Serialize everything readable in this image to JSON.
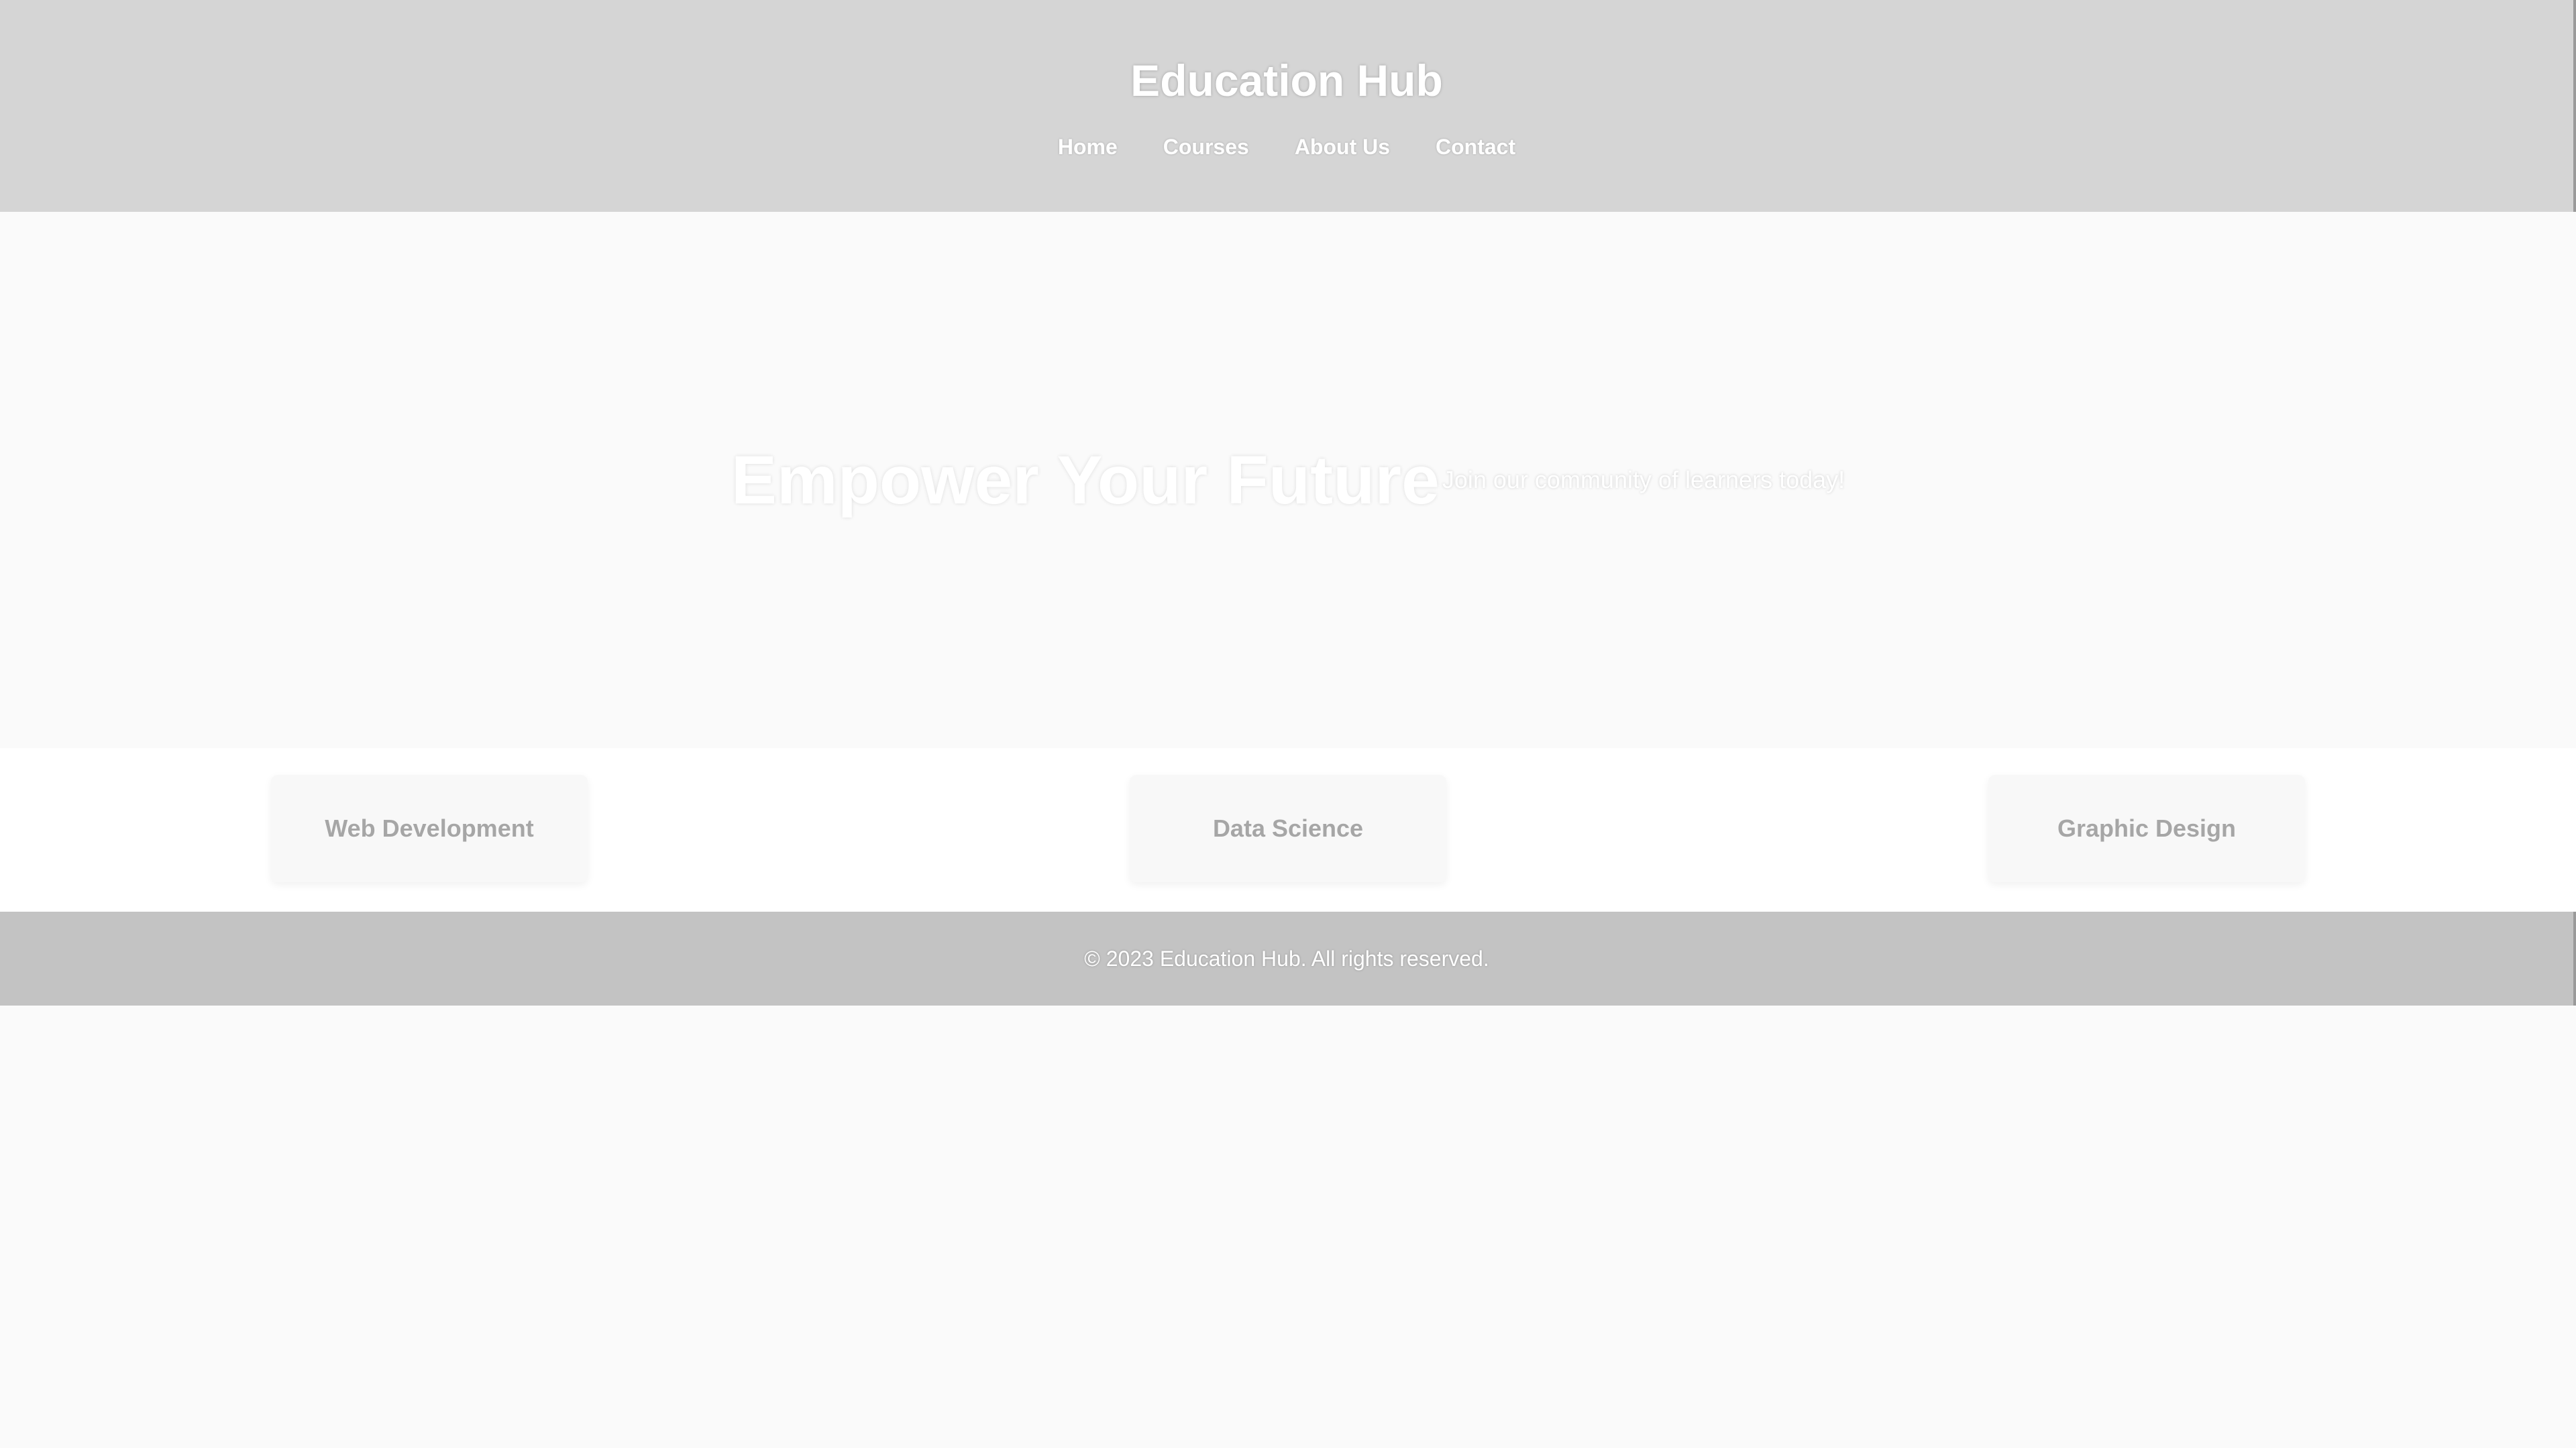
{
  "header": {
    "title": "Education Hub",
    "nav": [
      "Home",
      "Courses",
      "About Us",
      "Contact"
    ]
  },
  "hero": {
    "title": "Empower Your Future",
    "subtitle": "Join our community of learners today!"
  },
  "courses": [
    {
      "title": "Web Development"
    },
    {
      "title": "Data Science"
    },
    {
      "title": "Graphic Design"
    }
  ],
  "footer": {
    "text": "© 2023 Education Hub. All rights reserved."
  },
  "colors": {
    "header_bg": "#d5d5d5",
    "hero_bg": "#fafafa",
    "card_bg": "#f8f8f8",
    "card_text": "#a6a6a6",
    "footer_bg": "#c3c3c3"
  }
}
